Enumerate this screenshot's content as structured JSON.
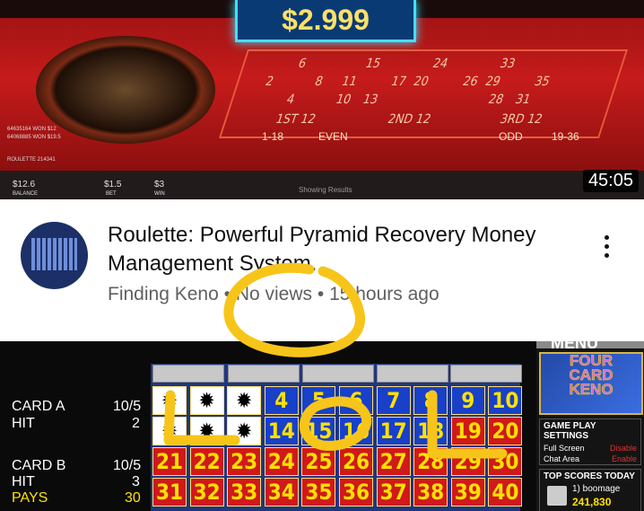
{
  "video1": {
    "jackpot": "$2.999",
    "duration": "45:05",
    "balance_value": "$12.6",
    "balance_label": "BALANCE",
    "bet_value": "$1.5",
    "bet_label": "BET",
    "win_value": "$3",
    "win_label": "WIN",
    "status_text": "Showing Results",
    "bet_1st12": "1ST 12",
    "bet_2nd12": "2ND 12",
    "bet_3rd12": "3RD 12",
    "bet_1_18": "1-18",
    "bet_even": "EVEN",
    "bet_odd": "ODD",
    "bet_19_36": "19-36",
    "grid_numbers": [
      "6",
      "15",
      "24",
      "33",
      "2",
      "8",
      "11",
      "17",
      "20",
      "26",
      "29",
      "35",
      "4",
      "10",
      "13",
      "28",
      "31"
    ],
    "side_lines": [
      "64635164 WON $12",
      "64068885 WON $19.5",
      "ROULETTE 214341"
    ],
    "title": "Roulette: Powerful Pyramid Recovery Money Management System.",
    "channel": "Finding Keno",
    "views": "No views",
    "age": "15 hours ago",
    "separator": "•"
  },
  "video2": {
    "card_a_label": "CARD A",
    "card_a_ratio": "10/5",
    "card_a_hit_label": "HIT",
    "card_a_hit": "2",
    "card_b_label": "CARD B",
    "card_b_ratio": "10/5",
    "card_b_hit_label": "HIT",
    "card_b_hit": "3",
    "pays_label": "PAYS",
    "pays_value": "30",
    "menu": "MENU",
    "logo_lines": [
      "FOUR",
      "CARD",
      "KENO"
    ],
    "settings_title": "GAME PLAY SETTINGS",
    "settings": [
      {
        "label": "Full Screen",
        "value": "Disable"
      },
      {
        "label": "Chat Area",
        "value": "Enable"
      }
    ],
    "top_scores_title": "TOP SCORES TODAY",
    "top_score_name": "1) boomage",
    "top_score_value": "241,830",
    "rows": [
      [
        "*",
        "*",
        "*",
        "4",
        "5",
        "6",
        "7",
        "8",
        "9",
        "10"
      ],
      [
        "*",
        "*",
        "*",
        "14",
        "15",
        "16",
        "17",
        "18",
        "19",
        "20"
      ],
      [
        "21",
        "22",
        "23",
        "24",
        "25",
        "26",
        "27",
        "28",
        "29",
        "30"
      ],
      [
        "31",
        "32",
        "33",
        "34",
        "35",
        "36",
        "37",
        "38",
        "39",
        "40"
      ]
    ]
  },
  "colors": {
    "annotation": "#f7c51a",
    "keno_blue": "#1840c8",
    "keno_red": "#d01919",
    "digit_yellow": "#ffe100"
  }
}
